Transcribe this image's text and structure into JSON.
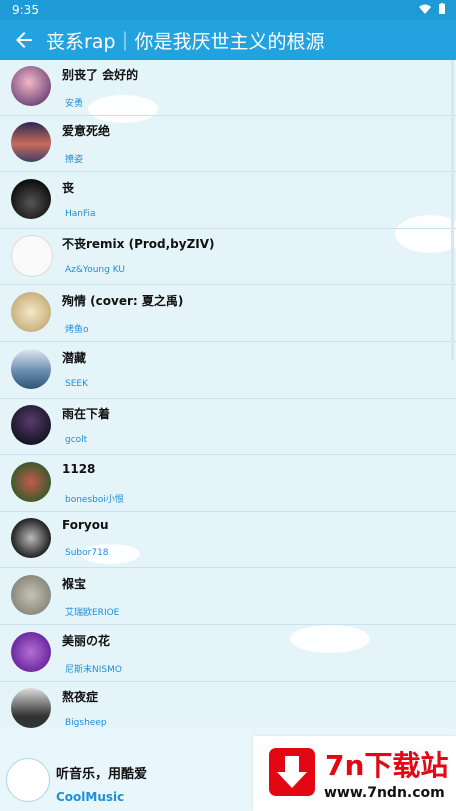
{
  "status": {
    "time": "9:35"
  },
  "app": {
    "title": "丧系rap｜你是我厌世主义的根源"
  },
  "songs": [
    {
      "title": "别丧了 会好的",
      "artist": "安勇"
    },
    {
      "title": "爱意死绝",
      "artist": "撩姿"
    },
    {
      "title": "丧",
      "artist": "HanFia"
    },
    {
      "title": "不丧remix (Prod,byZIV)",
      "artist": "Az&Young KU"
    },
    {
      "title": "殉情 (cover: 夏之禹)",
      "artist": "烤鱼o"
    },
    {
      "title": "潜藏",
      "artist": "SEEK"
    },
    {
      "title": "雨在下着",
      "artist": "gcolt"
    },
    {
      "title": "1128",
      "artist": "bonesboi小恨"
    },
    {
      "title": "Foryou",
      "artist": "Subor718"
    },
    {
      "title": "褓宝",
      "artist": "艾瑞欧ERIOE"
    },
    {
      "title": "美丽の花",
      "artist": "尼斯末NISMO"
    },
    {
      "title": "熬夜症",
      "artist": "Bigsheep"
    }
  ],
  "footer": {
    "slogan": "听音乐，用酷爱",
    "brand": "CoolMusic"
  },
  "watermark": {
    "big": "7n下载站",
    "small": "www.7ndn.com"
  },
  "colors": {
    "accent": "#22a3df",
    "artist": "#1f8fd8",
    "watermark": "#e30613"
  }
}
